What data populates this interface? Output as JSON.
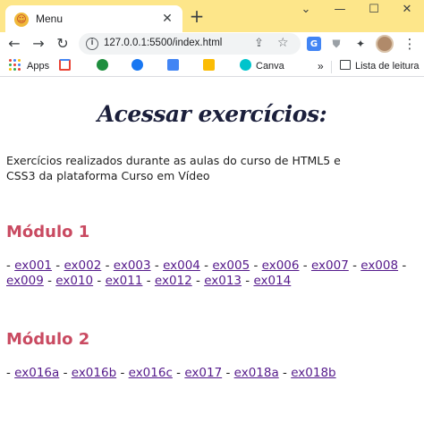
{
  "browser": {
    "tab_title": "Menu",
    "url": "127.0.0.1:5500/index.html",
    "bookmarks": {
      "apps": "Apps",
      "canva": "Canva",
      "more": "»",
      "reading_list": "Lista de leitura"
    },
    "colors": {
      "titlebar": "#fde68a"
    }
  },
  "page": {
    "title": "Acessar exercícios:",
    "intro": "Exercícios realizados durante as aulas do curso de HTML5 e CSS3 da plataforma Curso em Vídeo",
    "modules": [
      {
        "title": "Módulo 1",
        "exercises": [
          "ex001",
          "ex002",
          "ex003",
          "ex004",
          "ex005",
          "ex006",
          "ex007",
          "ex008",
          "ex009",
          "ex010",
          "ex011",
          "ex012",
          "ex013",
          "ex014"
        ]
      },
      {
        "title": "Módulo 2",
        "exercises": [
          "ex016a",
          "ex016b",
          "ex016c",
          "ex017",
          "ex018a",
          "ex018b"
        ]
      }
    ],
    "colors": {
      "module_title": "#c94a61",
      "link": "#551a8b",
      "page_title": "#1b1f3b"
    }
  }
}
